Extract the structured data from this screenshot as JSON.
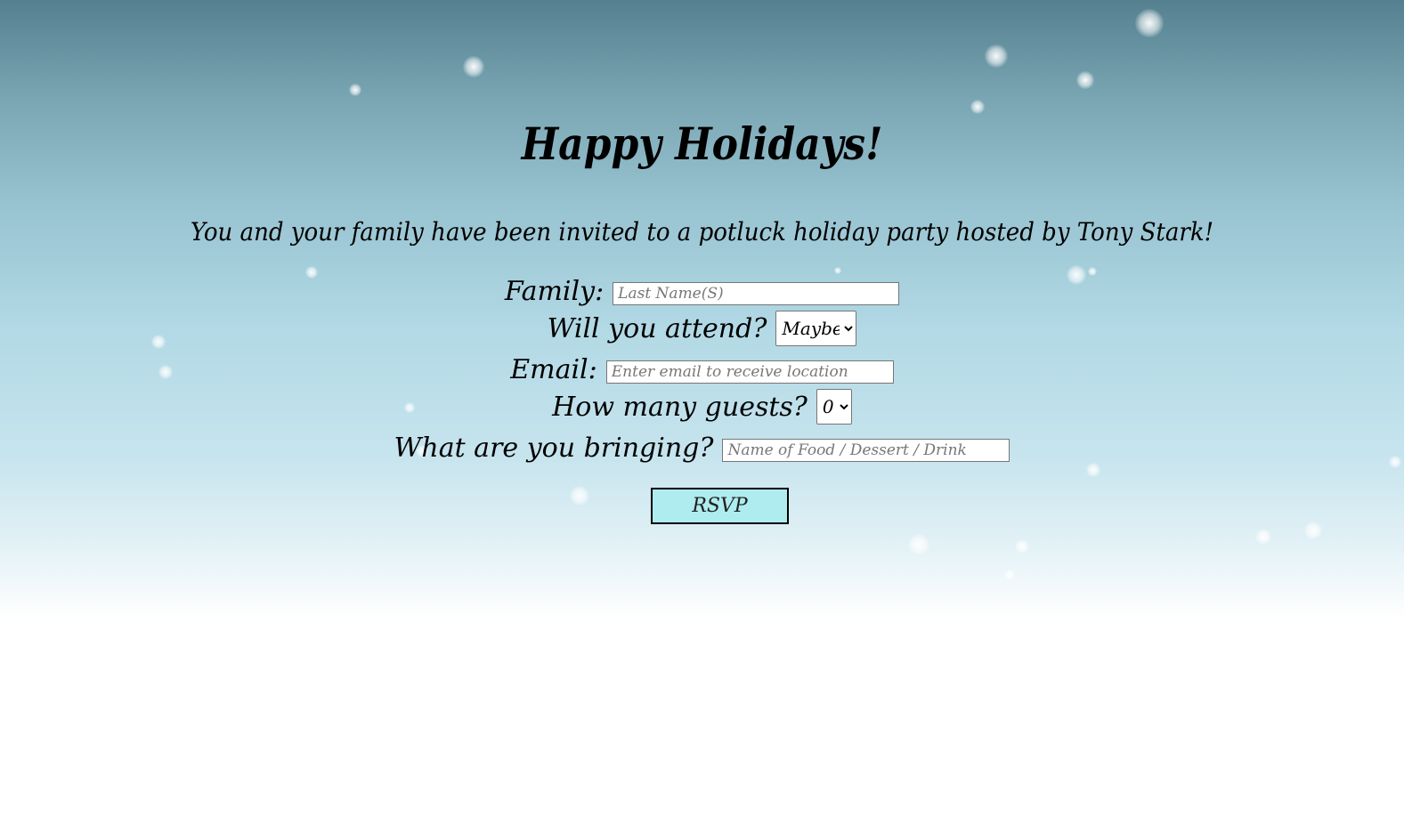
{
  "page": {
    "title": "Happy Holidays!",
    "invitation": "You and your family have been invited to a potluck holiday party hosted by Tony Stark!"
  },
  "form": {
    "family": {
      "label": "Family:",
      "placeholder": "Last Name(S)",
      "value": ""
    },
    "attend": {
      "label": "Will you attend?",
      "selected": "Maybe"
    },
    "email": {
      "label": "Email:",
      "placeholder": "Enter email to receive location",
      "value": ""
    },
    "guests": {
      "label": "How many guests?",
      "selected": "0"
    },
    "bringing": {
      "label": "What are you bringing?",
      "placeholder": "Name of Food / Dessert / Drink",
      "value": ""
    },
    "submit_label": "RSVP"
  },
  "colors": {
    "sky_top": "#55808f",
    "sky_mid": "#b2d9e5",
    "button_bg": "#aeecef"
  }
}
